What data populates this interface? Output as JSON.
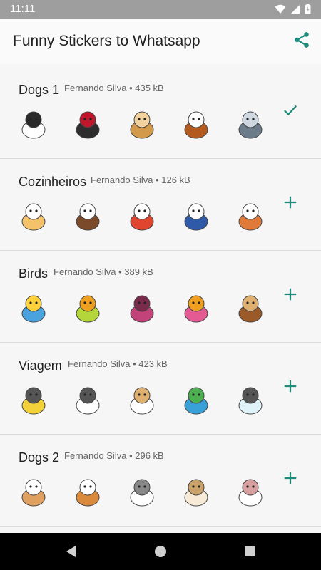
{
  "status_bar": {
    "time": "11:11"
  },
  "app_bar": {
    "title": "Funny Stickers to Whatsapp",
    "share_icon": "share-icon"
  },
  "colors": {
    "accent": "#1e8a7a"
  },
  "packs": [
    {
      "name": "Dogs 1",
      "author": "Fernando Silva",
      "size": "435 kB",
      "action": "added",
      "stickers": [
        {
          "icon": "dalmatian-sticker",
          "c1": "#ffffff",
          "c2": "#2a2a2a"
        },
        {
          "icon": "french-bulldog-sticker",
          "c1": "#2d2d2d",
          "c2": "#c0162b"
        },
        {
          "icon": "chihuahua-sticker",
          "c1": "#d49a4c",
          "c2": "#f2d3a0"
        },
        {
          "icon": "cavalier-spaniel-sticker",
          "c1": "#b55a1e",
          "c2": "#ffffff"
        },
        {
          "icon": "dog-in-car-sticker",
          "c1": "#6c7b8a",
          "c2": "#cfd8e0"
        }
      ]
    },
    {
      "name": "Cozinheiros",
      "author": "Fernando Silva",
      "size": "126 kB",
      "action": "add",
      "stickers": [
        {
          "icon": "chef-cake-sticker",
          "c1": "#f4c26b",
          "c2": "#ffffff"
        },
        {
          "icon": "chef-girl-sticker",
          "c1": "#7a4a2a",
          "c2": "#ffffff"
        },
        {
          "icon": "chef-red-hair-sticker",
          "c1": "#e0452f",
          "c2": "#ffffff"
        },
        {
          "icon": "chef-boy-sticker",
          "c1": "#2f5aa8",
          "c2": "#ffffff"
        },
        {
          "icon": "chef-pizza-sticker",
          "c1": "#e07a3a",
          "c2": "#ffffff"
        }
      ]
    },
    {
      "name": "Birds",
      "author": "Fernando Silva",
      "size": "389 kB",
      "action": "add",
      "stickers": [
        {
          "icon": "blue-bird-sticker",
          "c1": "#4aa3df",
          "c2": "#ffd23a"
        },
        {
          "icon": "green-bird-sticker",
          "c1": "#b4d63a",
          "c2": "#f0a020"
        },
        {
          "icon": "pink-owl-sticker",
          "c1": "#c2437a",
          "c2": "#7a2a4a"
        },
        {
          "icon": "pink-bird-sticker",
          "c1": "#e45a92",
          "c2": "#f0a020"
        },
        {
          "icon": "brown-owl-sticker",
          "c1": "#9a5a2a",
          "c2": "#e0b070"
        }
      ]
    },
    {
      "name": "Viagem",
      "author": "Fernando Silva",
      "size": "423 kB",
      "action": "add",
      "stickers": [
        {
          "icon": "yellow-car-sticker",
          "c1": "#f2d13a",
          "c2": "#555555"
        },
        {
          "icon": "loaded-car-sticker",
          "c1": "#ffffff",
          "c2": "#555555"
        },
        {
          "icon": "airplane-sticker",
          "c1": "#ffffff",
          "c2": "#e0b070"
        },
        {
          "icon": "globe-sticker",
          "c1": "#3aa0d8",
          "c2": "#4caf50"
        },
        {
          "icon": "balloon-sticker",
          "c1": "#dff3f8",
          "c2": "#555555"
        }
      ]
    },
    {
      "name": "Dogs 2",
      "author": "Fernando Silva",
      "size": "296 kB",
      "action": "add",
      "stickers": [
        {
          "icon": "corgi-sticker",
          "c1": "#e0a060",
          "c2": "#ffffff"
        },
        {
          "icon": "corgi-leash-sticker",
          "c1": "#d98a3a",
          "c2": "#ffffff"
        },
        {
          "icon": "poodle-sticker",
          "c1": "#ffffff",
          "c2": "#888888"
        },
        {
          "icon": "pomeranian-sticker",
          "c1": "#f7ead7",
          "c2": "#c9a26a"
        },
        {
          "icon": "bull-terrier-sticker",
          "c1": "#ffffff",
          "c2": "#d9a0a0"
        }
      ]
    }
  ],
  "nav_bar": {
    "back_icon": "back-icon",
    "home_icon": "home-icon",
    "recents_icon": "recents-icon"
  }
}
